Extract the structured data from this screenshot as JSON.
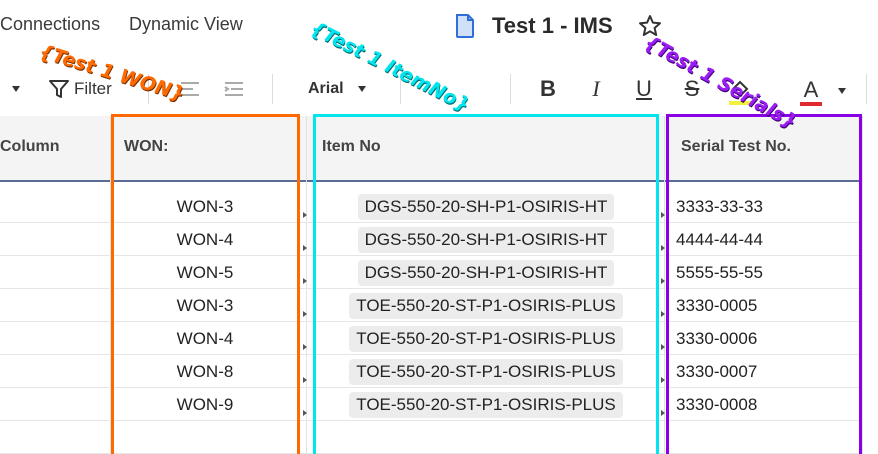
{
  "nav": {
    "connections": "Connections",
    "dynamic_view": "Dynamic View"
  },
  "document": {
    "title": "Test 1 - IMS"
  },
  "toolbar": {
    "filter_label": "Filter",
    "font": "Arial",
    "bold": "B",
    "italic": "I",
    "underline": "U",
    "strike": "S",
    "text_color": "A"
  },
  "headers": {
    "column": "Column",
    "won": "WON:",
    "item_no": "Item No",
    "serial": "Serial Test No."
  },
  "rows": [
    {
      "won": "WON-3",
      "item": "DGS-550-20-SH-P1-OSIRIS-HT",
      "serial": "3333-33-33"
    },
    {
      "won": "WON-4",
      "item": "DGS-550-20-SH-P1-OSIRIS-HT",
      "serial": "4444-44-44"
    },
    {
      "won": "WON-5",
      "item": "DGS-550-20-SH-P1-OSIRIS-HT",
      "serial": "5555-55-55"
    },
    {
      "won": "WON-3",
      "item": "TOE-550-20-ST-P1-OSIRIS-PLUS",
      "serial": "3330-0005"
    },
    {
      "won": "WON-4",
      "item": "TOE-550-20-ST-P1-OSIRIS-PLUS",
      "serial": "3330-0006"
    },
    {
      "won": "WON-8",
      "item": "TOE-550-20-ST-P1-OSIRIS-PLUS",
      "serial": "3330-0007"
    },
    {
      "won": "WON-9",
      "item": "TOE-550-20-ST-P1-OSIRIS-PLUS",
      "serial": "3330-0008"
    }
  ],
  "annotations": {
    "won": "{Test 1 WON}",
    "item_no": "{Test 1 ItemNo}",
    "serials": "{Test 1 Serials}"
  },
  "colors": {
    "orange": "#ff6a00",
    "cyan": "#00e5ee",
    "purple": "#8a00e6",
    "header_rule": "#5a6b96"
  }
}
